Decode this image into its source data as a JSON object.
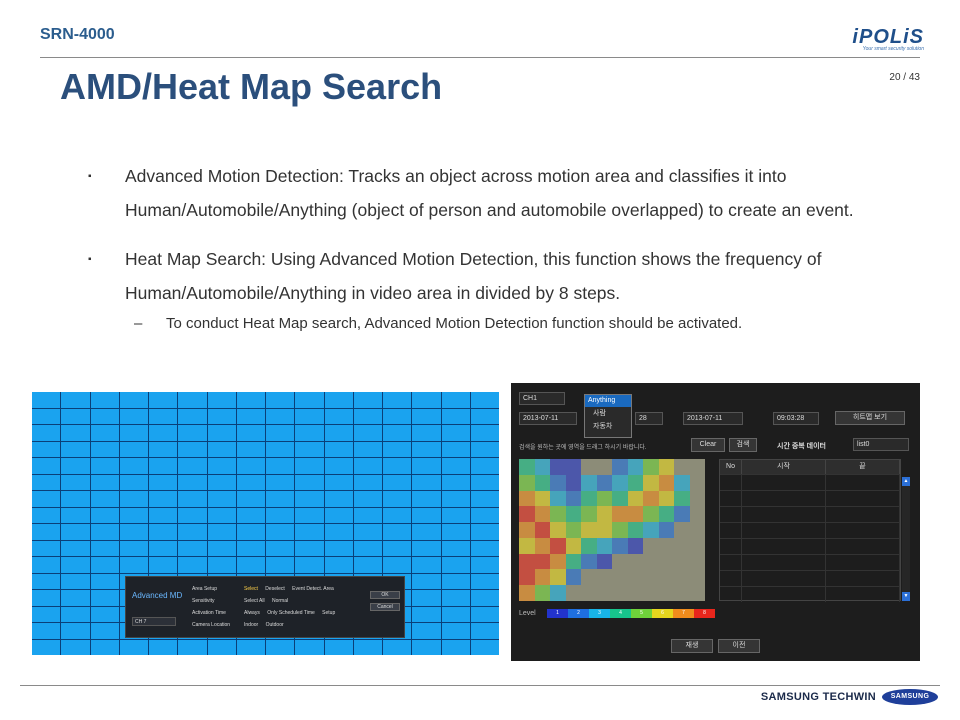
{
  "header": {
    "product": "SRN-4000",
    "title": "AMD/Heat Map Search",
    "page": "20 / 43",
    "logo_text": "iPOLiS",
    "logo_tagline": "Your smart security solution"
  },
  "bullets": [
    {
      "text": "Advanced Motion Detection: Tracks an object across motion area and classifies it into Human/Automobile/Anything (object of person and automobile overlapped) to create an event."
    },
    {
      "text": "Heat Map Search: Using Advanced Motion Detection, this function shows the frequency of Human/Automobile/Anything in video area in divided by 8 steps."
    }
  ],
  "sub_bullet": {
    "text": "To conduct Heat Map search, Advanced Motion Detection function should be activated."
  },
  "bullet_mark": "▪",
  "sub_mark": "–",
  "amd_panel": {
    "name": "Advanced MD",
    "channel": "CH 7",
    "rows": [
      "Area Setup",
      "Sensitivity",
      "Activation Time",
      "Camera Location"
    ],
    "area_options": [
      "Select",
      "Deselect",
      "Event Detect. Area"
    ],
    "select_all": "Select All",
    "sensitivity": "Normal",
    "time_options": [
      "Always",
      "Only Scheduled Time",
      "Setup"
    ],
    "location_options": [
      "Indoor",
      "Outdoor"
    ],
    "ok": "OK",
    "cancel": "Cancel"
  },
  "heatmap_ui": {
    "channel": "CH1",
    "start_date": "2013-07-11",
    "start_time": "28",
    "end_date": "2013-07-11",
    "end_time": "09:03:28",
    "heatmap_button": "히트맵 보기",
    "dropdown": {
      "selected": "Anything",
      "items": [
        "사람",
        "자동차"
      ]
    },
    "instruction": "검색을 원하는 곳에 영역을 드래그 하시기 바랍니다.",
    "clear": "Clear",
    "search": "검색",
    "overlap_label": "시간 중복 데이터",
    "list_value": "list0",
    "columns": [
      "No",
      "시작",
      "끝"
    ],
    "level_label": "Level",
    "levels": [
      "1",
      "2",
      "3",
      "4",
      "5",
      "6",
      "7",
      "8"
    ],
    "level_colors": [
      "#2233cc",
      "#1e6fe0",
      "#18b4e8",
      "#17c48c",
      "#6fd23a",
      "#e6d61e",
      "#f08c1c",
      "#e8261c"
    ],
    "play": "재생",
    "prev": "이전"
  },
  "footer": {
    "techwin": "SAMSUNG TECHWIN",
    "samsung": "SAMSUNG"
  }
}
